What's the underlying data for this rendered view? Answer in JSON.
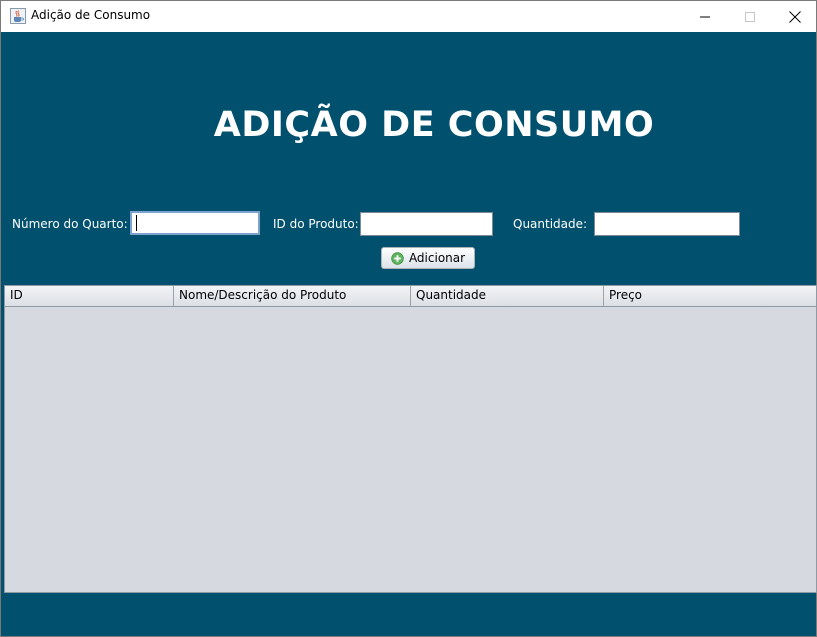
{
  "window": {
    "title": "Adição de Consumo",
    "app_icon": "java-cup-icon",
    "controls": [
      "minimize-icon",
      "maximize-icon",
      "close-icon"
    ]
  },
  "heading": "ADIÇÃO DE CONSUMO",
  "form": {
    "room_label": "Número do Quarto:",
    "room_value": "",
    "product_label": "ID do Produto:",
    "product_value": "",
    "quantity_label": "Quantidade:",
    "quantity_value": "",
    "add_button": "Adicionar",
    "add_icon": "plus-circle-icon"
  },
  "table": {
    "columns": [
      "ID",
      "Nome/Descrição do Produto",
      "Quantidade",
      "Preço"
    ],
    "rows": []
  },
  "colors": {
    "background": "#00506e",
    "table_bg": "#d6d9e0",
    "heading_text": "#ffffff"
  }
}
